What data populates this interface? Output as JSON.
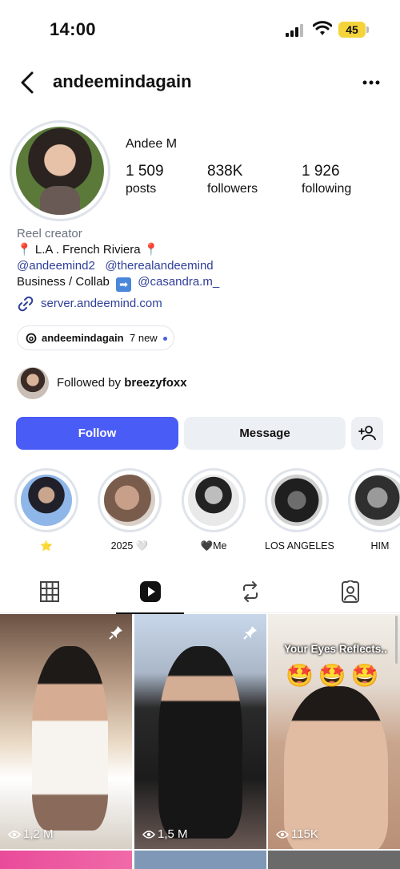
{
  "status_bar": {
    "time": "14:00",
    "battery": "45"
  },
  "header": {
    "username": "andeemindagain"
  },
  "profile": {
    "display_name": "Andee M",
    "stats": {
      "posts": {
        "value": "1 509",
        "label": "posts"
      },
      "followers": {
        "value": "838K",
        "label": "followers"
      },
      "following": {
        "value": "1 926",
        "label": "following"
      }
    }
  },
  "bio": {
    "category": "Reel creator",
    "location": "L.A . French Riviera",
    "mention1": "@andeemind2",
    "mention2": "@therealandeemind",
    "collab_prefix": "Business / Collab",
    "collab_arrow": "➡",
    "collab_handle": "@casandra.m_",
    "website": "server.andeemind.com"
  },
  "threads": {
    "handle": "andeemindagain",
    "new_label": "7 new"
  },
  "followed_by": {
    "prefix": "Followed by",
    "user": "breezyfoxx"
  },
  "actions": {
    "follow": "Follow",
    "message": "Message"
  },
  "highlights": [
    {
      "label": "⭐"
    },
    {
      "label": "2025 🤍"
    },
    {
      "label": "🖤Me"
    },
    {
      "label": "LOS ANGELES"
    },
    {
      "label": "HIM"
    }
  ],
  "tabs": [
    {
      "name": "grid",
      "icon": "grid-icon"
    },
    {
      "name": "reels",
      "icon": "reels-icon",
      "active": true
    },
    {
      "name": "reposts",
      "icon": "repost-icon"
    },
    {
      "name": "tagged",
      "icon": "tagged-icon"
    }
  ],
  "reels": [
    {
      "views": "1,2 M",
      "pinned": true
    },
    {
      "views": "1,5 M",
      "pinned": true
    },
    {
      "views": "115K",
      "pinned": false,
      "caption": "Your Eyes Reflects..",
      "emoji": "🤩🤩🤩"
    }
  ],
  "colors": {
    "accent": "#4a5cf6",
    "link": "#2f3f9a",
    "battery": "#f4d43a"
  }
}
